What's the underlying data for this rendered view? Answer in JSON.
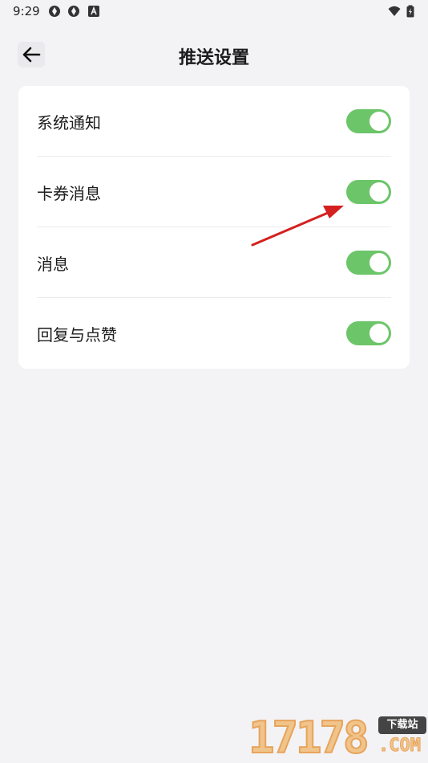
{
  "status_bar": {
    "time": "9:29",
    "icons": [
      "app-notification-icon",
      "app-notification-icon",
      "a-letter-icon",
      "wifi-icon",
      "battery-icon"
    ]
  },
  "header": {
    "back_icon": "arrow-left-icon",
    "title": "推送设置"
  },
  "settings": {
    "items": [
      {
        "label": "系统通知",
        "enabled": true
      },
      {
        "label": "卡券消息",
        "enabled": true
      },
      {
        "label": "消息",
        "enabled": true
      },
      {
        "label": "回复与点赞",
        "enabled": true
      }
    ]
  },
  "colors": {
    "background": "#f3f3f6",
    "card": "#ffffff",
    "toggle_on": "#6cc569",
    "annotation_arrow": "#d42020"
  },
  "watermark": {
    "digits": "17178",
    "badge": "下载站",
    "suffix": ".COM"
  }
}
